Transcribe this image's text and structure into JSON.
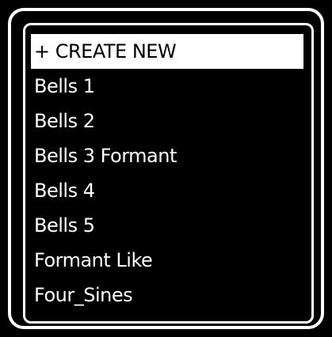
{
  "preset_menu": {
    "items": [
      {
        "label": "+ CREATE NEW",
        "selected": true
      },
      {
        "label": "Bells 1",
        "selected": false
      },
      {
        "label": "Bells 2",
        "selected": false
      },
      {
        "label": "Bells 3 Formant",
        "selected": false
      },
      {
        "label": "Bells 4",
        "selected": false
      },
      {
        "label": "Bells 5",
        "selected": false
      },
      {
        "label": "Formant Like",
        "selected": false
      },
      {
        "label": "Four_Sines",
        "selected": false
      }
    ]
  },
  "colors": {
    "background": "#000000",
    "foreground": "#ffffff"
  }
}
